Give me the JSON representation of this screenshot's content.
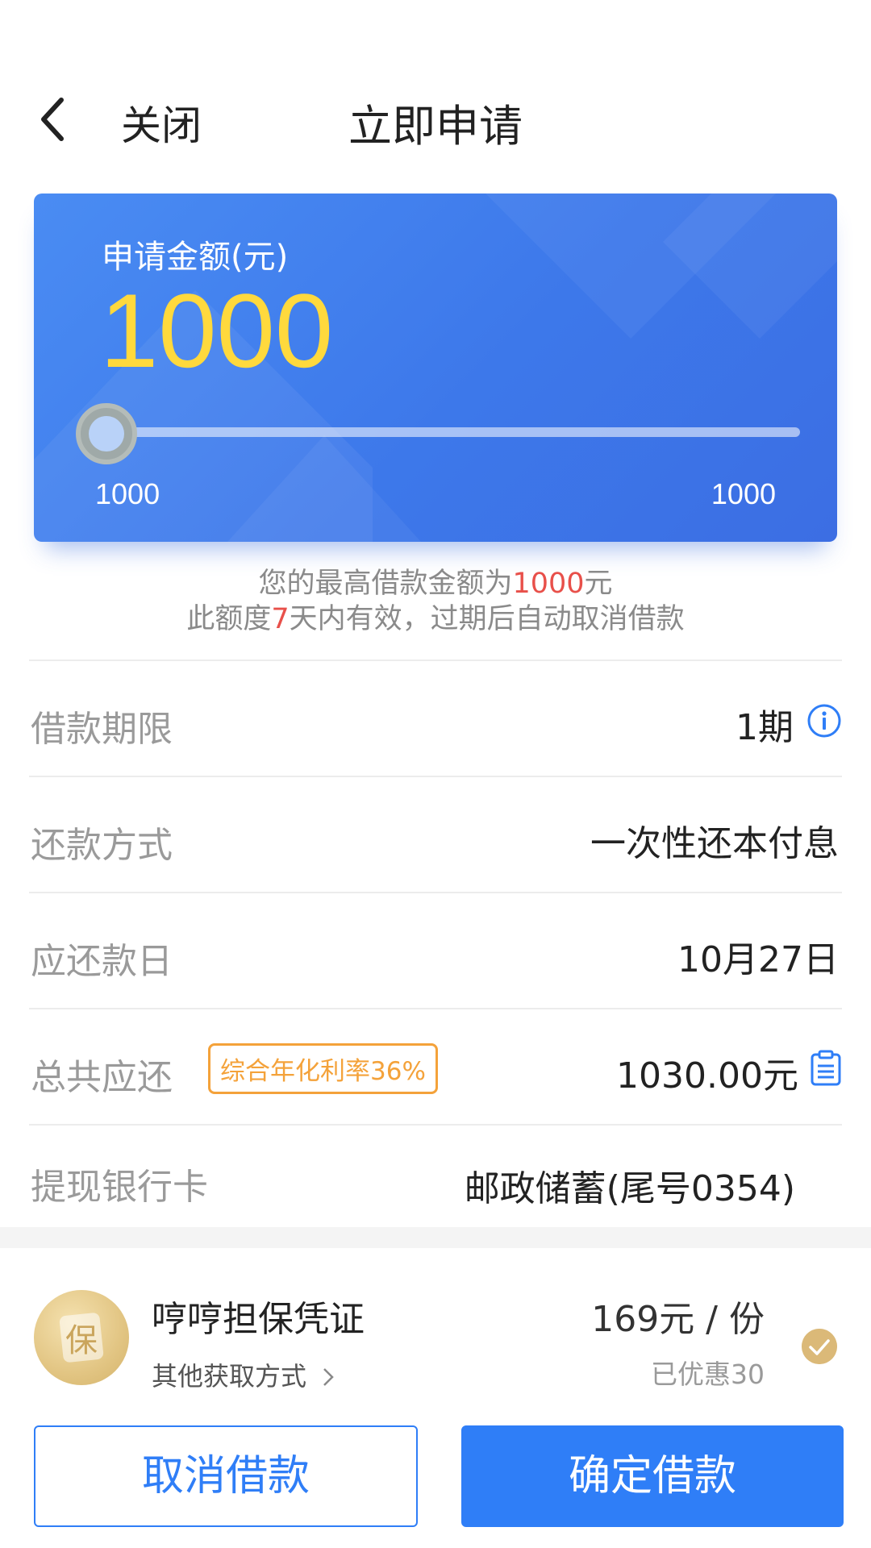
{
  "header": {
    "close_label": "关闭",
    "title": "立即申请"
  },
  "card": {
    "amount_label": "申请金额(元)",
    "amount_value": "1000",
    "range_min": "1000",
    "range_max": "1000",
    "slider_fraction": 0.0
  },
  "notes": {
    "line1_prefix": "您的最高借款金额为",
    "line1_amount": "1000",
    "line1_suffix": "元",
    "line2_prefix": "此额度",
    "line2_days": "7",
    "line2_suffix": "天内有效，过期后自动取消借款"
  },
  "rows": {
    "term_label": "借款期限",
    "term_value": "1期",
    "method_label": "还款方式",
    "method_value": "一次性还本付息",
    "due_label": "应还款日",
    "due_value": "10月27日",
    "total_label": "总共应还",
    "total_badge": "综合年化利率36%",
    "total_value": "1030.00元",
    "card_label": "提现银行卡",
    "card_value": "邮政储蓄(尾号0354)"
  },
  "voucher": {
    "icon_char": "保",
    "title": "哼哼担保凭证",
    "link": "其他获取方式",
    "price": "169元 / 份",
    "discount": "已优惠30"
  },
  "buttons": {
    "cancel": "取消借款",
    "confirm": "确定借款"
  },
  "colors": {
    "primary": "#2f7ef7",
    "amount": "#ffd93d",
    "highlight": "#e8504a",
    "badge": "#f4a23a",
    "gold": "#dbb978"
  }
}
